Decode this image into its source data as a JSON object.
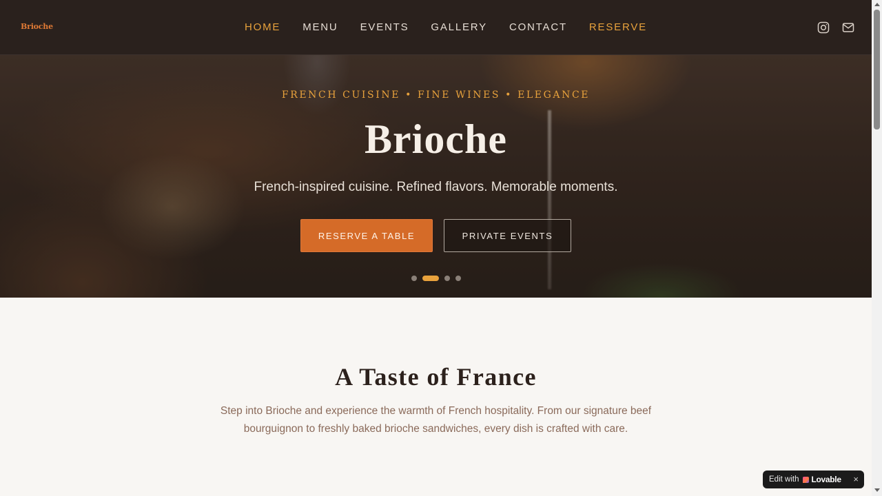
{
  "header": {
    "logo": "Brioche",
    "nav": [
      "HOME",
      "MENU",
      "EVENTS",
      "GALLERY",
      "CONTACT",
      "RESERVE"
    ],
    "active_index": 0,
    "icons": [
      "instagram-icon",
      "mail-icon"
    ]
  },
  "hero": {
    "kicker": "FRENCH CUISINE • FINE WINES • ELEGANCE",
    "title": "Brioche",
    "subtitle": "French-inspired cuisine. Refined flavors. Memorable moments.",
    "primary_button": "RESERVE A TABLE",
    "secondary_button": "PRIVATE EVENTS",
    "slides": 4,
    "active_slide": 1
  },
  "intro": {
    "title": "A Taste of France",
    "text": "Step into Brioche and experience the warmth of French hospitality. From our signature beef bourguignon to freshly baked brioche sandwiches, every dish is crafted with care."
  },
  "badge": {
    "prefix": "Edit with",
    "brand": "Lovable",
    "close": "×"
  },
  "colors": {
    "accent": "#e8a23c",
    "button": "#d56b28",
    "header_bg": "#2a211d",
    "page_bg": "#f8f6f3"
  }
}
